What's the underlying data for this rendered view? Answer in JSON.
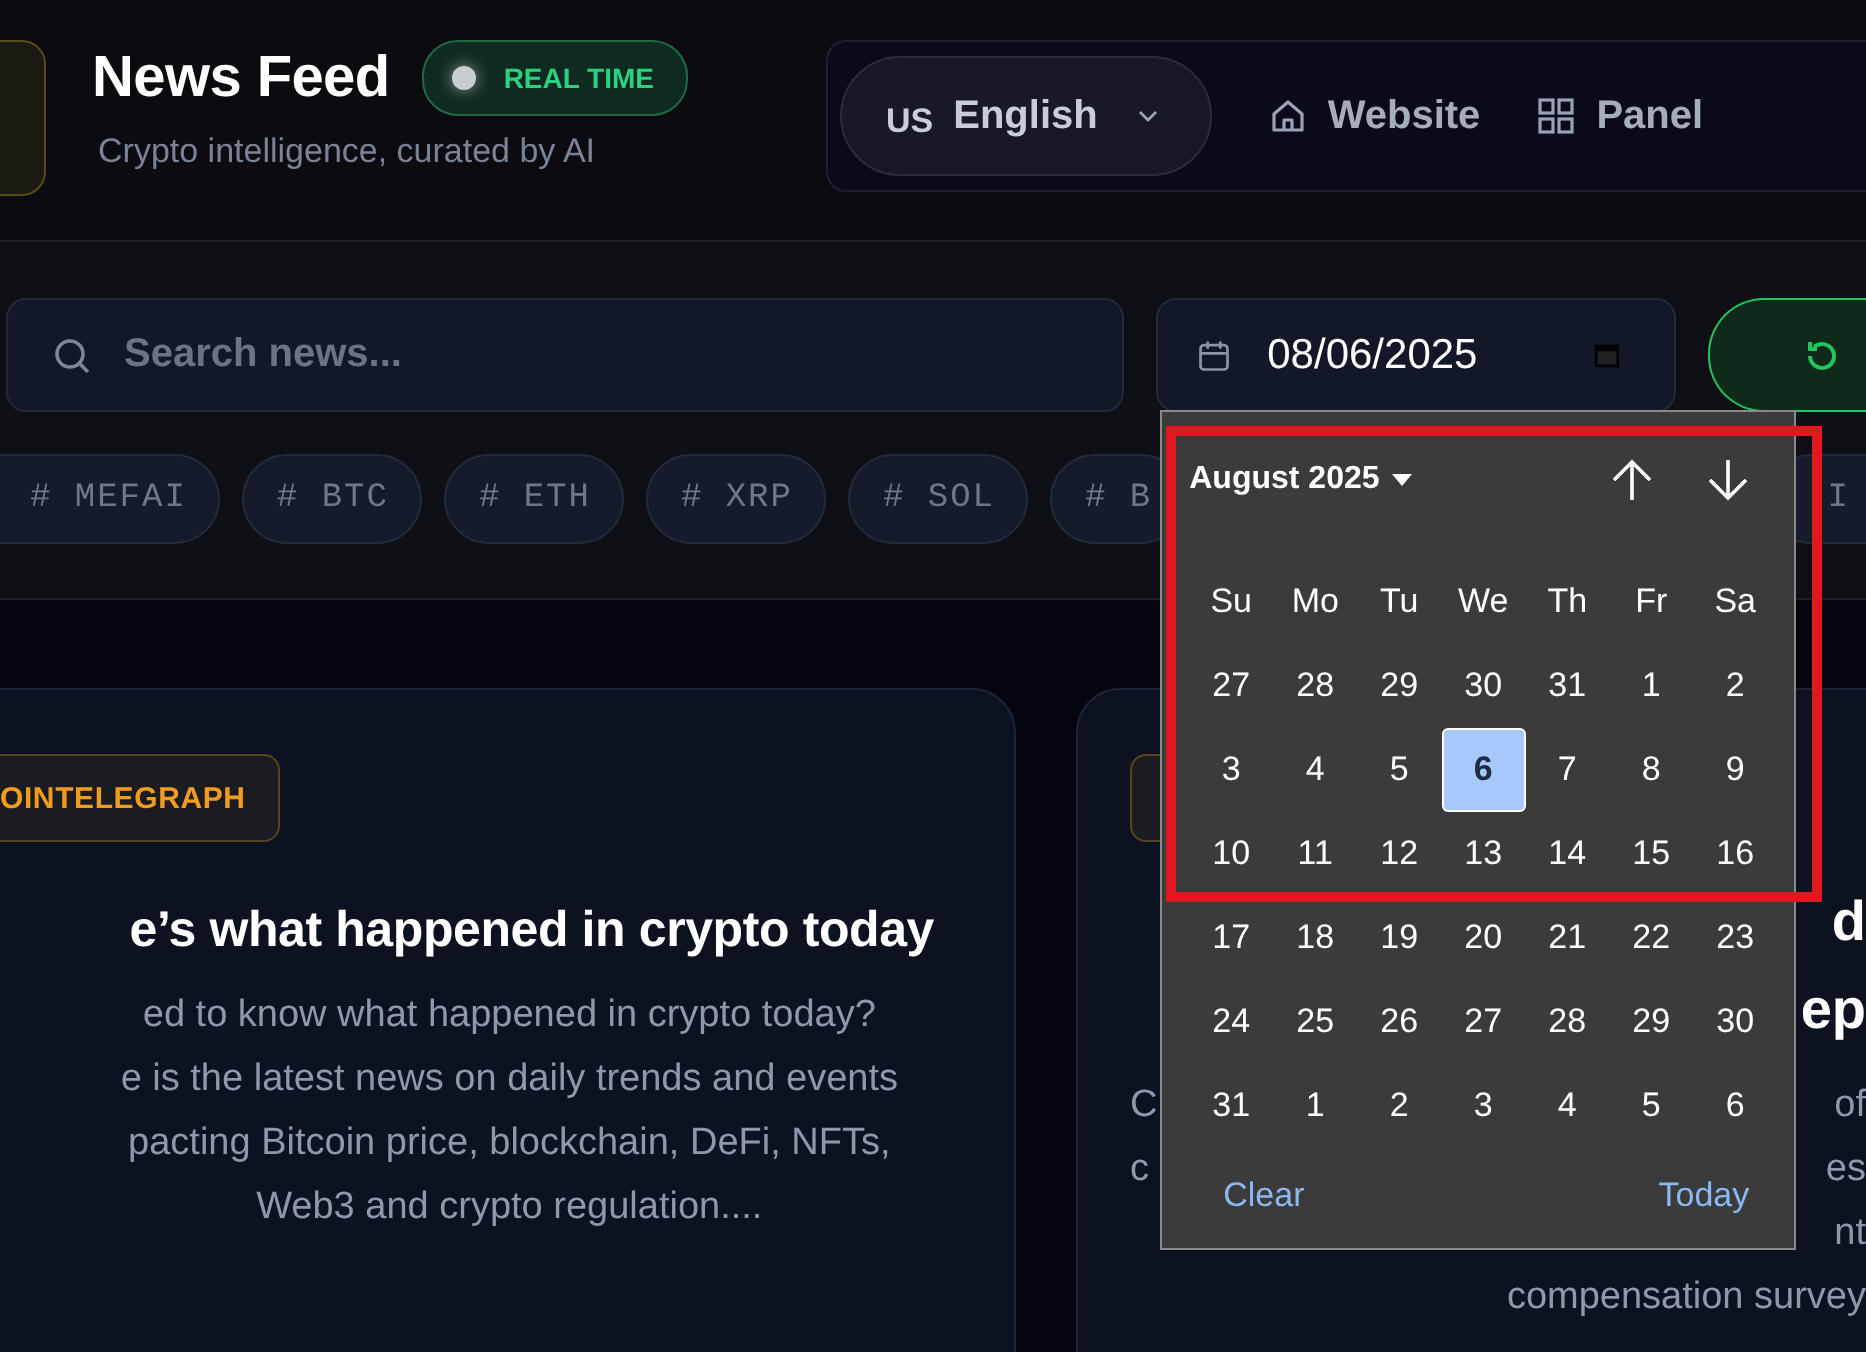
{
  "header": {
    "title": "News Feed",
    "live_badge": {
      "label": "REAL TIME",
      "on": true
    },
    "subtitle": "Crypto intelligence, curated by AI"
  },
  "nav": {
    "language": {
      "code": "US",
      "label": "English"
    },
    "links": [
      {
        "label": "Website",
        "kind": "home"
      },
      {
        "label": "Panel",
        "kind": "grid"
      }
    ]
  },
  "search": {
    "placeholder": "Search news..."
  },
  "date_field": {
    "value": "08/06/2025"
  },
  "tags": [
    {
      "label": "# MEFAI"
    },
    {
      "label": "# BTC"
    },
    {
      "label": "# ETH"
    },
    {
      "label": "# XRP"
    },
    {
      "label": "# SOL"
    },
    {
      "label": "# B"
    },
    {
      "label": "I"
    }
  ],
  "cards": [
    {
      "source": "OINTELEGRAPH",
      "title": "e’s what happened in crypto today",
      "summary_lines": [
        "ed to know what happened in crypto today?",
        "e is the latest news on daily trends and events",
        "pacting Bitcoin price, blockchain, DeFi, NFTs,",
        "Web3 and crypto regulation...."
      ]
    },
    {
      "title_fragments": [
        "d",
        "ep"
      ],
      "summary_rows": [
        {
          "left": "C",
          "right": "of"
        },
        {
          "left": "c",
          "right": "es"
        },
        {
          "right": "nt"
        },
        {
          "right": "compensation survey"
        }
      ]
    }
  ],
  "date_picker": {
    "month_label": "August 2025",
    "weekdays": [
      "Su",
      "Mo",
      "Tu",
      "We",
      "Th",
      "Fr",
      "Sa"
    ],
    "weeks": [
      [
        {
          "day": "27",
          "selected": false
        },
        {
          "day": "28",
          "selected": false
        },
        {
          "day": "29",
          "selected": false
        },
        {
          "day": "30",
          "selected": false
        },
        {
          "day": "31",
          "selected": false
        },
        {
          "day": "1",
          "selected": false
        },
        {
          "day": "2",
          "selected": false
        }
      ],
      [
        {
          "day": "3",
          "selected": false
        },
        {
          "day": "4",
          "selected": false
        },
        {
          "day": "5",
          "selected": false
        },
        {
          "day": "6",
          "selected": true
        },
        {
          "day": "7",
          "selected": false
        },
        {
          "day": "8",
          "selected": false
        },
        {
          "day": "9",
          "selected": false
        }
      ],
      [
        {
          "day": "10",
          "selected": false
        },
        {
          "day": "11",
          "selected": false
        },
        {
          "day": "12",
          "selected": false
        },
        {
          "day": "13",
          "selected": false
        },
        {
          "day": "14",
          "selected": false
        },
        {
          "day": "15",
          "selected": false
        },
        {
          "day": "16",
          "selected": false
        }
      ],
      [
        {
          "day": "17",
          "selected": false
        },
        {
          "day": "18",
          "selected": false
        },
        {
          "day": "19",
          "selected": false
        },
        {
          "day": "20",
          "selected": false
        },
        {
          "day": "21",
          "selected": false
        },
        {
          "day": "22",
          "selected": false
        },
        {
          "day": "23",
          "selected": false
        }
      ],
      [
        {
          "day": "24",
          "selected": false
        },
        {
          "day": "25",
          "selected": false
        },
        {
          "day": "26",
          "selected": false
        },
        {
          "day": "27",
          "selected": false
        },
        {
          "day": "28",
          "selected": false
        },
        {
          "day": "29",
          "selected": false
        },
        {
          "day": "30",
          "selected": false
        }
      ],
      [
        {
          "day": "31",
          "selected": false
        },
        {
          "day": "1",
          "selected": false
        },
        {
          "day": "2",
          "selected": false
        },
        {
          "day": "3",
          "selected": false
        },
        {
          "day": "4",
          "selected": false
        },
        {
          "day": "5",
          "selected": false
        },
        {
          "day": "6",
          "selected": false
        }
      ]
    ],
    "actions": [
      "Clear",
      "Today"
    ]
  }
}
